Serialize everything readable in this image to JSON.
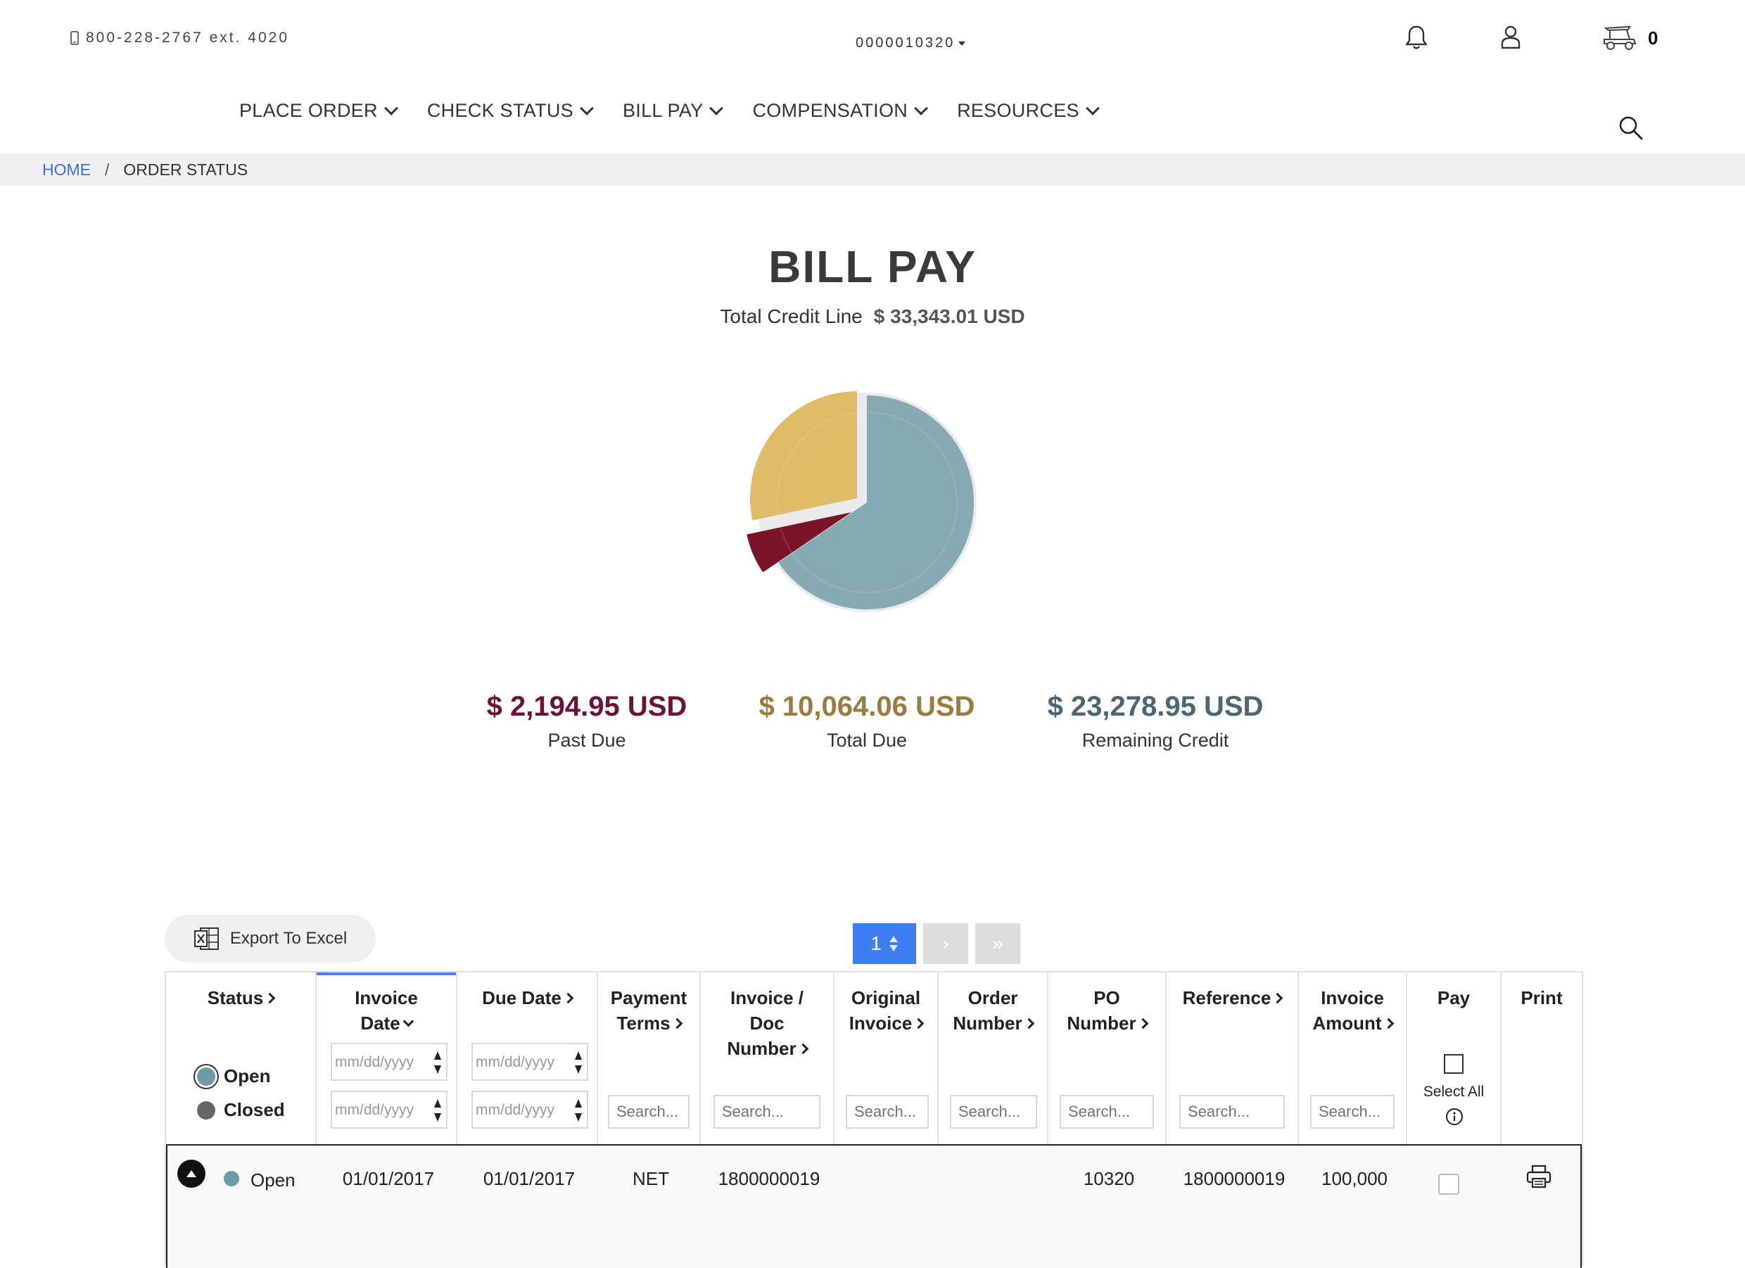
{
  "header": {
    "phone": "800-228-2767 ext. 4020",
    "account_number": "0000010320",
    "cart_count": "0"
  },
  "nav": {
    "items": [
      {
        "label": "PLACE ORDER"
      },
      {
        "label": "CHECK STATUS"
      },
      {
        "label": "BILL PAY"
      },
      {
        "label": "COMPENSATION"
      },
      {
        "label": "RESOURCES"
      }
    ]
  },
  "breadcrumb": {
    "home": "HOME",
    "separator": "/",
    "current": "ORDER STATUS"
  },
  "page": {
    "title": "BILL PAY",
    "credit_label": "Total Credit Line",
    "credit_amount": "$ 33,343.01 USD"
  },
  "chart_data": {
    "type": "pie",
    "slices": [
      {
        "label": "Past Due",
        "value": 2194.95,
        "color": "#7a1428"
      },
      {
        "label": "Total Due",
        "value": 10064.06,
        "color": "#e0bb68"
      },
      {
        "label": "Remaining Credit",
        "value": 23278.95,
        "color": "#87a9b3"
      }
    ]
  },
  "summary": {
    "past_due": {
      "value": "$ 2,194.95 USD",
      "label": "Past Due",
      "color": "#6b1530"
    },
    "total_due": {
      "value": "$ 10,064.06 USD",
      "label": "Total Due",
      "color": "#9c7a3e"
    },
    "remaining": {
      "value": "$ 23,278.95 USD",
      "label": "Remaining Credit",
      "color": "#4a6670"
    }
  },
  "toolbar": {
    "export_label": "Export To Excel",
    "page": "1",
    "next": "›",
    "last": "»"
  },
  "table": {
    "headers": {
      "status": "Status",
      "invoice_date_1": "Invoice",
      "invoice_date_2": "Date",
      "due_date": "Due Date",
      "payment_terms_1": "Payment",
      "payment_terms_2": "Terms",
      "invoice_doc_1": "Invoice /",
      "invoice_doc_2": "Doc",
      "invoice_doc_3": "Number",
      "original_1": "Original",
      "original_2": "Invoice",
      "order_1": "Order",
      "order_2": "Number",
      "po_1": "PO",
      "po_2": "Number",
      "reference": "Reference",
      "amount_1": "Invoice",
      "amount_2": "Amount",
      "pay": "Pay",
      "print": "Print"
    },
    "status_options": {
      "open": "Open",
      "closed": "Closed"
    },
    "date_placeholder": "mm/dd/yyyy",
    "search_placeholder": "Search...",
    "select_all": "Select All",
    "status_colors": {
      "open": "#6b9ba8",
      "closed": "#666666"
    },
    "rows": [
      {
        "status": "Open",
        "invoice_date": "01/01/2017",
        "due_date": "01/01/2017",
        "payment_terms": "NET",
        "invoice_doc": "1800000019",
        "original_invoice": "",
        "order_number": "",
        "po_number": "10320",
        "reference": "1800000019",
        "invoice_amount": "100,000"
      }
    ]
  }
}
